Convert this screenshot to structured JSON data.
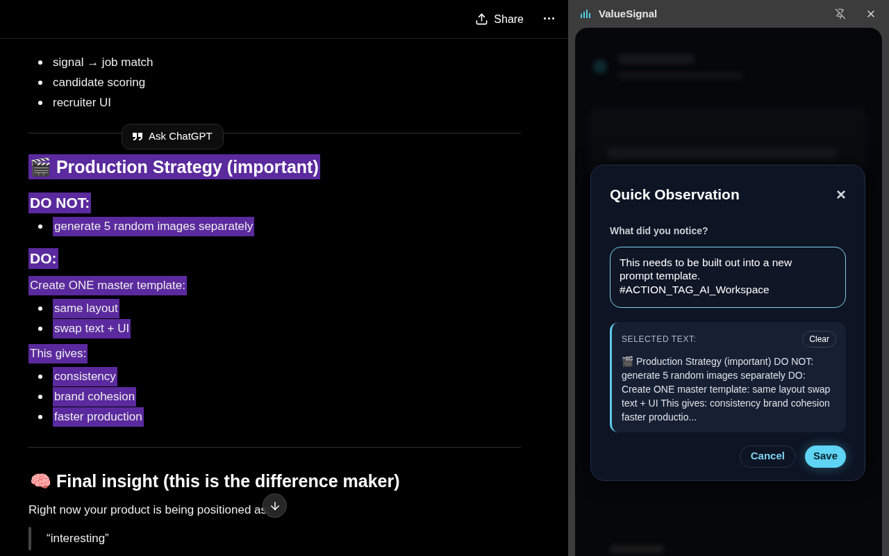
{
  "chat": {
    "share_label": "Share",
    "more_label": "···",
    "ask_label": "Ask ChatGPT",
    "blocks": [
      {
        "kind": "bullets",
        "highlighted": false,
        "items": [
          "signal → job match",
          "candidate scoring",
          "recruiter UI"
        ]
      },
      {
        "kind": "divider"
      },
      {
        "kind": "heading",
        "highlighted": true,
        "text": "🎬 Production Strategy (important)"
      },
      {
        "kind": "subheading",
        "highlighted": true,
        "text": "DO NOT:"
      },
      {
        "kind": "bullets",
        "highlighted": true,
        "items": [
          "generate 5 random images separately"
        ]
      },
      {
        "kind": "subheading",
        "highlighted": true,
        "text": "DO:"
      },
      {
        "kind": "paragraph",
        "highlighted": true,
        "text": "Create ONE master template:"
      },
      {
        "kind": "bullets",
        "highlighted": true,
        "items": [
          "same layout",
          "swap text + UI"
        ]
      },
      {
        "kind": "paragraph",
        "highlighted": true,
        "text": "This gives:"
      },
      {
        "kind": "bullets",
        "highlighted": true,
        "items": [
          "consistency",
          "brand cohesion",
          "faster production"
        ]
      },
      {
        "kind": "divider"
      },
      {
        "kind": "heading",
        "highlighted": false,
        "text": "🧠 Final insight (this is the difference maker)"
      },
      {
        "kind": "paragraph",
        "highlighted": false,
        "text": "Right now your product is being positioned as:"
      },
      {
        "kind": "quote",
        "highlighted": false,
        "text": "“interesting”"
      }
    ]
  },
  "panel": {
    "title": "ValueSignal",
    "dialog": {
      "title": "Quick Observation",
      "close_label": "×",
      "field_label": "What did you notice?",
      "value": "This needs to be built out into a new prompt template. #ACTION_TAG_AI_Workspace",
      "selected_label": "SELECTED TEXT:",
      "clear_label": "Clear",
      "selected_text": "🎬 Production Strategy (important) DO NOT: generate 5 random images separately DO: Create ONE master template: same layout swap text + UI This gives: consistency brand cohesion faster productio...",
      "buttons": [
        {
          "kind": "secondary",
          "label": "Cancel"
        },
        {
          "kind": "primary",
          "label": "Save"
        }
      ]
    }
  }
}
